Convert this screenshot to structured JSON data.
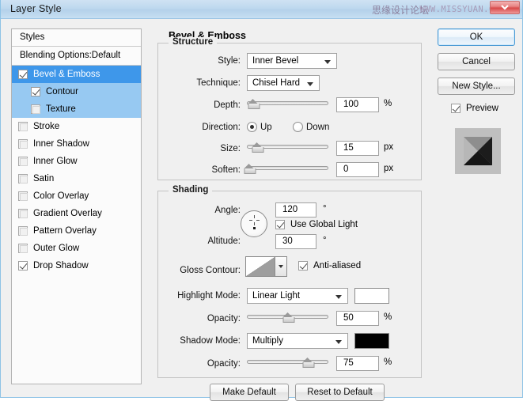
{
  "window": {
    "title": "Layer Style",
    "watermark_cn": "思缘设计论坛",
    "watermark_url": "WWW.MISSYUAN.COM",
    "close_icon": "close-icon"
  },
  "styles_panel": {
    "header": "Styles",
    "blending_options": "Blending Options:Default",
    "items": [
      {
        "label": "Bevel & Emboss",
        "checked": true,
        "selected": "main",
        "indent": false
      },
      {
        "label": "Contour",
        "checked": true,
        "selected": "sub",
        "indent": true
      },
      {
        "label": "Texture",
        "checked": false,
        "selected": "sub",
        "indent": true
      },
      {
        "label": "Stroke",
        "checked": false,
        "selected": "none",
        "indent": false
      },
      {
        "label": "Inner Shadow",
        "checked": false,
        "selected": "none",
        "indent": false
      },
      {
        "label": "Inner Glow",
        "checked": false,
        "selected": "none",
        "indent": false
      },
      {
        "label": "Satin",
        "checked": false,
        "selected": "none",
        "indent": false
      },
      {
        "label": "Color Overlay",
        "checked": false,
        "selected": "none",
        "indent": false
      },
      {
        "label": "Gradient Overlay",
        "checked": false,
        "selected": "none",
        "indent": false
      },
      {
        "label": "Pattern Overlay",
        "checked": false,
        "selected": "none",
        "indent": false
      },
      {
        "label": "Outer Glow",
        "checked": false,
        "selected": "none",
        "indent": false
      },
      {
        "label": "Drop Shadow",
        "checked": true,
        "selected": "none",
        "indent": false
      }
    ]
  },
  "main": {
    "heading": "Bevel & Emboss",
    "structure": {
      "title": "Structure",
      "style_label": "Style:",
      "style_value": "Inner Bevel",
      "technique_label": "Technique:",
      "technique_value": "Chisel Hard",
      "depth_label": "Depth:",
      "depth_value": "100",
      "depth_unit": "%",
      "direction_label": "Direction:",
      "direction_up": "Up",
      "direction_down": "Down",
      "direction_selected": "Up",
      "size_label": "Size:",
      "size_value": "15",
      "size_unit": "px",
      "soften_label": "Soften:",
      "soften_value": "0",
      "soften_unit": "px"
    },
    "shading": {
      "title": "Shading",
      "angle_label": "Angle:",
      "angle_value": "120",
      "angle_unit": "°",
      "use_global_light": "Use Global Light",
      "use_global_light_checked": true,
      "altitude_label": "Altitude:",
      "altitude_value": "30",
      "altitude_unit": "°",
      "gloss_contour_label": "Gloss Contour:",
      "anti_aliased": "Anti-aliased",
      "anti_aliased_checked": true,
      "highlight_mode_label": "Highlight Mode:",
      "highlight_mode_value": "Linear Light",
      "highlight_color": "#ffffff",
      "highlight_opacity_label": "Opacity:",
      "highlight_opacity_value": "50",
      "highlight_opacity_unit": "%",
      "shadow_mode_label": "Shadow Mode:",
      "shadow_mode_value": "Multiply",
      "shadow_color": "#000000",
      "shadow_opacity_label": "Opacity:",
      "shadow_opacity_value": "75",
      "shadow_opacity_unit": "%"
    },
    "make_default": "Make Default",
    "reset_to_default": "Reset to Default"
  },
  "right": {
    "ok": "OK",
    "cancel": "Cancel",
    "new_style": "New Style...",
    "preview": "Preview",
    "preview_checked": true
  },
  "colors": {
    "selection_blue": "#3e97ea",
    "selection_light_blue": "#97c9f2",
    "titlebar_blue": "#b4d1ea",
    "panel_gray": "#f0f0f0"
  }
}
